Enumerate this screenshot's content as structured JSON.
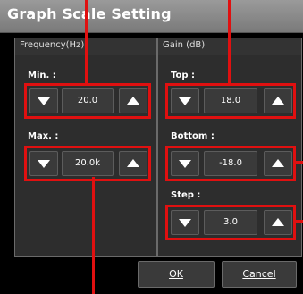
{
  "dialog": {
    "title": "Graph Scale Setting"
  },
  "frequency": {
    "group_title": "Frequency(Hz)",
    "min_label": "Min. :",
    "min_value": "20.0",
    "max_label": "Max. :",
    "max_value": "20.0k"
  },
  "gain": {
    "group_title": "Gain (dB)",
    "top_label": "Top :",
    "top_value": "18.0",
    "bottom_label": "Bottom :",
    "bottom_value": "-18.0",
    "step_label": "Step :",
    "step_value": "3.0"
  },
  "buttons": {
    "ok_label": "OK",
    "cancel_label": "Cancel"
  },
  "colors": {
    "highlight": "#e01010",
    "dialog_bg": "#000000",
    "group_bg": "#2d2d2d",
    "title_bar": "#8a8a8a"
  },
  "icons": {
    "decrement": "triangle-down-icon",
    "increment": "triangle-up-icon"
  }
}
